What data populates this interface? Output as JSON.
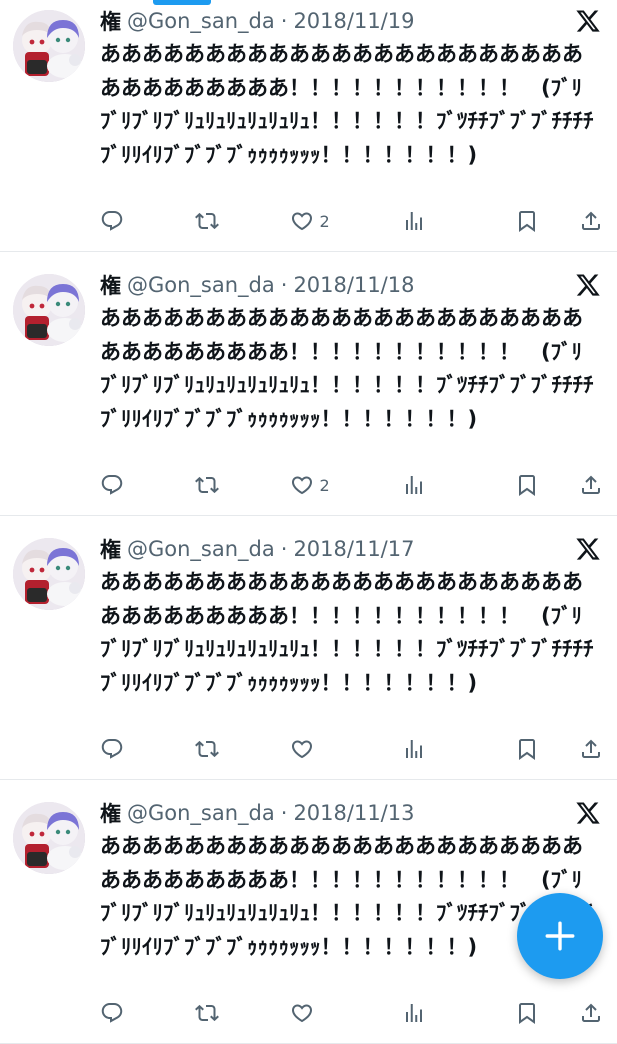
{
  "tweets": [
    {
      "name": "権",
      "handle": "@Gon_san_da",
      "separator": "·",
      "date": "2018/11/19",
      "text": "ああああああああああああああああああああああああああああああああ！！！！！！！！！！！　(ﾌﾞﾘﾌﾞﾘﾌﾞﾘﾌﾞﾘｭﾘｭﾘｭﾘｭﾘｭﾘｭ！！！！！！ﾌﾞﾂﾁﾁﾌﾞﾌﾞﾌﾞﾁﾁﾁﾁﾌﾞﾘﾘｲﾘﾌﾞﾌﾞﾌﾞﾌﾞｩｩｩｩｯｯｯ！！！！！！！)",
      "like_count": "2"
    },
    {
      "name": "権",
      "handle": "@Gon_san_da",
      "separator": "·",
      "date": "2018/11/18",
      "text": "ああああああああああああああああああああああああああああああああ！！！！！！！！！！！　(ﾌﾞﾘﾌﾞﾘﾌﾞﾘﾌﾞﾘｭﾘｭﾘｭﾘｭﾘｭﾘｭ！！！！！！ﾌﾞﾂﾁﾁﾌﾞﾌﾞﾌﾞﾁﾁﾁﾁﾌﾞﾘﾘｲﾘﾌﾞﾌﾞﾌﾞﾌﾞｩｩｩｩｯｯｯ！！！！！！！)",
      "like_count": "2"
    },
    {
      "name": "権",
      "handle": "@Gon_san_da",
      "separator": "·",
      "date": "2018/11/17",
      "text": "ああああああああああああああああああああああああああああああああ！！！！！！！！！！！　(ﾌﾞﾘﾌﾞﾘﾌﾞﾘﾌﾞﾘｭﾘｭﾘｭﾘｭﾘｭﾘｭ！！！！！！ﾌﾞﾂﾁﾁﾌﾞﾌﾞﾌﾞﾁﾁﾁﾁﾌﾞﾘﾘｲﾘﾌﾞﾌﾞﾌﾞﾌﾞｩｩｩｩｯｯｯ！！！！！！！)",
      "like_count": ""
    },
    {
      "name": "権",
      "handle": "@Gon_san_da",
      "separator": "·",
      "date": "2018/11/13",
      "text": "ああああああああああああああああああああああああああああああああ！！！！！！！！！！！　(ﾌﾞﾘﾌﾞﾘﾌﾞﾘﾌﾞﾘｭﾘｭﾘｭﾘｭﾘｭﾘｭ！！！！！！ﾌﾞﾂﾁﾁﾌﾞﾌﾞﾌﾞﾁﾁﾁﾁﾌﾞﾘﾘｲﾘﾌﾞﾌﾞﾌﾞﾌﾞｩｩｩｩｯｯｯ！！！！！！！)",
      "like_count": ""
    }
  ],
  "icons": {
    "reply": "reply-icon",
    "retweet": "retweet-icon",
    "like": "heart-icon",
    "views": "views-icon",
    "bookmark": "bookmark-icon",
    "share": "share-icon",
    "platform": "x-logo-icon",
    "compose": "plus-icon"
  },
  "colors": {
    "accent": "#1d9bf0",
    "text": "#0f1419",
    "muted": "#536471",
    "divider": "#e6e9ec"
  }
}
